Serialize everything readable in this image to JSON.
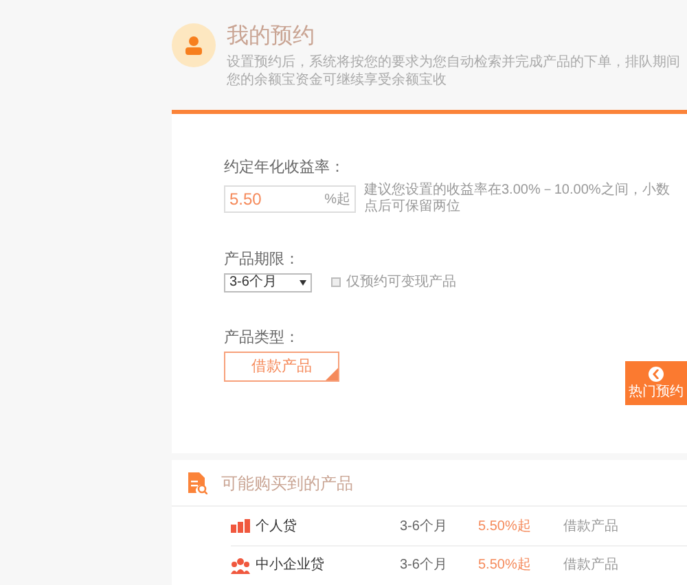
{
  "header": {
    "title": "我的预约",
    "description": "设置预约后，系统将按您的要求为您自动检索并完成产品的下单，排队期间您的余额宝资金可继续享受余额宝收"
  },
  "form": {
    "rate": {
      "label": "约定年化收益率：",
      "value": "5.50",
      "suffix": "%起",
      "hint": "建议您设置的收益率在3.00%－10.00%之间，小数点后可保留两位"
    },
    "term": {
      "label": "产品期限：",
      "value": "3-6个月",
      "option_label": "仅预约可变现产品",
      "checked": false
    },
    "type": {
      "label": "产品类型：",
      "options": [
        {
          "label": "借款产品",
          "selected": true
        }
      ]
    }
  },
  "float_button": {
    "label": "热门预约"
  },
  "products": {
    "title": "可能购买到的产品",
    "rows": [
      {
        "kind": "personal",
        "name": "个人贷",
        "term": "3-6个月",
        "rate": "5.50%起",
        "type": "借款产品"
      },
      {
        "kind": "business",
        "name": "中小企业贷",
        "term": "3-6个月",
        "rate": "5.50%起",
        "type": "借款产品"
      }
    ]
  }
}
